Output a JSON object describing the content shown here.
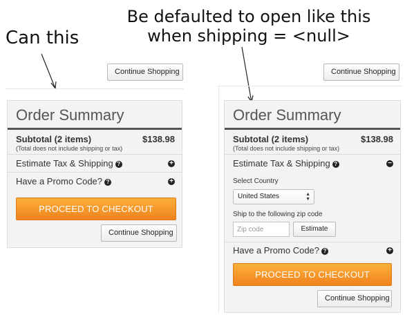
{
  "annotations": {
    "left": "Can this",
    "top_line1": "Be defaulted to open like this",
    "top_line2": "when shipping = <null>"
  },
  "left_panel": {
    "continue_top": "Continue Shopping",
    "title": "Order Summary",
    "subtotal_label": "Subtotal (2 items)",
    "subtotal_note": "(Total does not include shipping or tax)",
    "subtotal_amount": "$138.98",
    "estimate_label": "Estimate Tax & Shipping",
    "estimate_toggle": "+",
    "promo_label": "Have a Promo Code?",
    "promo_toggle": "+",
    "checkout_label": "PROCEED TO CHECKOUT",
    "continue_bottom": "Continue Shopping"
  },
  "right_panel": {
    "continue_top": "Continue Shopping",
    "title": "Order Summary",
    "subtotal_label": "Subtotal (2 items)",
    "subtotal_note": "(Total does not include shipping or tax)",
    "subtotal_amount": "$138.98",
    "estimate_label": "Estimate Tax & Shipping",
    "estimate_toggle": "−",
    "select_country_label": "Select Country",
    "country_value": "United States",
    "zip_label": "Ship to the following zip code",
    "zip_placeholder": "Zip code",
    "estimate_button": "Estimate",
    "promo_label": "Have a Promo Code?",
    "promo_toggle": "+",
    "checkout_label": "PROCEED TO CHECKOUT",
    "continue_bottom": "Continue Shopping"
  },
  "icons": {
    "help": "?",
    "arrows": "▲▼"
  },
  "colors": {
    "checkout_top": "#fbb03b",
    "checkout_bottom": "#f0821e",
    "panel_bg": "#f3f3f3",
    "title_rule": "#555555"
  }
}
